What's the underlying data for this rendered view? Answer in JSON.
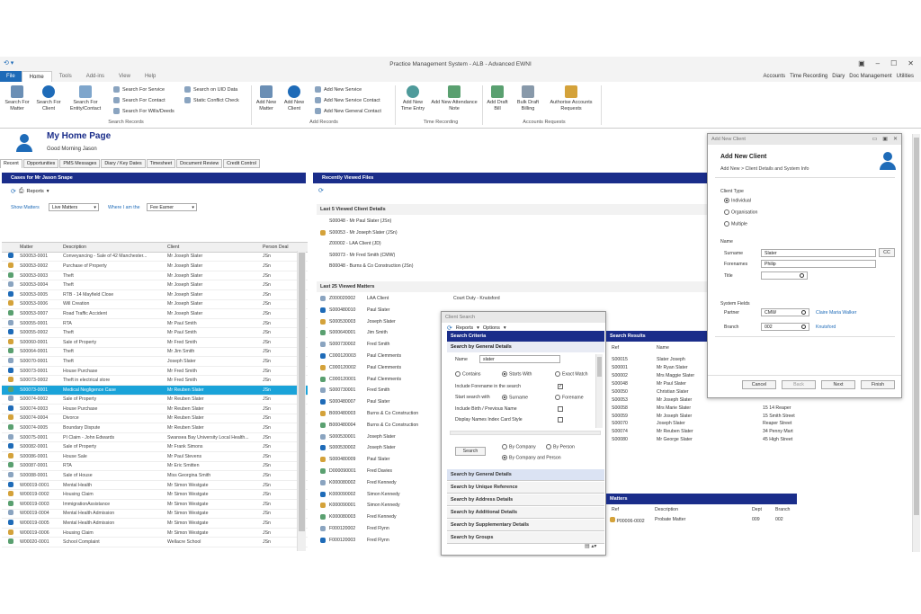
{
  "window": {
    "title": "Practice Management System - ALB - Advanced EWNI"
  },
  "menu": {
    "file": "File",
    "tabs": [
      "Home",
      "Tools",
      "Add-ins",
      "View",
      "Help"
    ],
    "right_links": [
      "Accounts",
      "Time Recording",
      "Diary",
      "Doc Management",
      "Utilities"
    ]
  },
  "ribbon": {
    "search_records": {
      "label": "Search Records",
      "buttons": [
        "Search For Matter",
        "Search For Client",
        "Search For Entity/Contact"
      ],
      "small": [
        "Search For Service",
        "Search For Contact",
        "Search For Wills/Deeds",
        "Search on UID Data",
        "Static Conflict Check"
      ]
    },
    "add_records": {
      "label": "Add Records",
      "buttons": [
        "Add New Matter",
        "Add New Client"
      ],
      "small": [
        "Add New Service",
        "Add New Service Contact",
        "Add New General Contact"
      ]
    },
    "time_recording": {
      "label": "Time Recording",
      "buttons": [
        "Add New Time Entry",
        "Add New Attendance Note"
      ]
    },
    "accounts_requests": {
      "label": "Accounts Requests",
      "buttons": [
        "Add Draft Bill",
        "Bulk Draft Billing",
        "Authorise Accounts Requests"
      ]
    }
  },
  "home": {
    "title": "My Home Page",
    "greeting": "Good Morning Jason"
  },
  "page_tabs": [
    "Recent",
    "Opportunities",
    "PMS Messages",
    "Diary / Key Dates",
    "Timesheet",
    "Document Review",
    "Credit Control"
  ],
  "cases": {
    "title": "Cases for Mr Jason Snape",
    "reports": "Reports",
    "show_matters_label": "Show Matters",
    "show_matters_value": "Live Matters",
    "where_label": "Where I am the",
    "where_value": "Fee Earner",
    "columns": [
      "Matter",
      "Description",
      "Client",
      "Person Deal"
    ],
    "rows": [
      [
        "S00053-0001",
        "Conveyancing - Sale of 42 Manchester...",
        "Mr Joseph Slater",
        "JSn"
      ],
      [
        "S00053-0002",
        "Purchase of Property",
        "Mr Joseph Slater",
        "JSn"
      ],
      [
        "S00053-0003",
        "Theft",
        "Mr Joseph Slater",
        "JSn"
      ],
      [
        "S00053-0004",
        "Theft",
        "Mr Joseph Slater",
        "JSn"
      ],
      [
        "S00053-0005",
        "RTB - 14 Mayfield Close",
        "Mr Joseph Slater",
        "JSn"
      ],
      [
        "S00053-0006",
        "Will Creation",
        "Mr Joseph Slater",
        "JSn"
      ],
      [
        "S00053-0007",
        "Road Traffic Accident",
        "Mr Joseph Slater",
        "JSn"
      ],
      [
        "S00055-0001",
        "RTA",
        "Mr Paul Smith",
        "JSn"
      ],
      [
        "S00055-0002",
        "Theft",
        "Mr Paul Smith",
        "JSn"
      ],
      [
        "S00060-0001",
        "Sale of Property",
        "Mr Fred Smith",
        "JSn"
      ],
      [
        "S00064-0001",
        "Theft",
        "Mr Jim Smith",
        "JSn"
      ],
      [
        "S00070-0001",
        "Theft",
        "Joseph Slater",
        "JSn"
      ],
      [
        "S00073-0001",
        "House Purchase",
        "Mr Fred Smith",
        "JSn"
      ],
      [
        "S00073-0002",
        "Theft in electrical store",
        "Mr Fred Smith",
        "JSn"
      ],
      [
        "S00073-0001",
        "Medical Negligence Case",
        "Mr Reuben Slater",
        "JSn"
      ],
      [
        "S00074-0002",
        "Sale of Property",
        "Mr Reuben Slater",
        "JSn"
      ],
      [
        "S00074-0003",
        "House Purchase",
        "Mr Reuben Slater",
        "JSn"
      ],
      [
        "S00074-0004",
        "Divorce",
        "Mr Reuben Slater",
        "JSn"
      ],
      [
        "S00074-0005",
        "Boundary Dispute",
        "Mr Reuben Slater",
        "JSn"
      ],
      [
        "S00075-0001",
        "PI Claim - John Edwards",
        "Swansea Bay University Local Health...",
        "JSn"
      ],
      [
        "S00082-0001",
        "Sale of Property",
        "Mr Frank Simons",
        "JSn"
      ],
      [
        "S00086-0001",
        "House Sale",
        "Mr Paul Stevens",
        "JSn"
      ],
      [
        "S00087-0001",
        "RTA",
        "Mr Eric Smitten",
        "JSn"
      ],
      [
        "S00088-0001",
        "Sale of House",
        "Miss Georgina Smith",
        "JSn"
      ],
      [
        "W00019-0001",
        "Mental Health",
        "Mr Simon Westgate",
        "JSn"
      ],
      [
        "W00019-0002",
        "Housing Claim",
        "Mr Simon Westgate",
        "JSn"
      ],
      [
        "W00019-0003",
        "ImmigrationAssistance",
        "Mr Simon Westgate",
        "JSn"
      ],
      [
        "W00019-0004",
        "Mental Health Admission",
        "Mr Simon Westgate",
        "JSn"
      ],
      [
        "W00019-0005",
        "Mental Health Admission",
        "Mr Simon Westgate",
        "JSn"
      ],
      [
        "W00019-0006",
        "Housing Claim",
        "Mr Simon Westgate",
        "JSn"
      ],
      [
        "W00020-0001",
        "School Complaint",
        "Wellacre School",
        "JSn"
      ]
    ]
  },
  "recent": {
    "title": "Recently Viewed Files",
    "clients_header": "Last 5 Viewed Client Details",
    "clients": [
      "S00048 - Mr Paul Slater (JSn)",
      "S00053 - Mr Joseph Slater (JSn)",
      "Z00002 - LAA Client (JD)",
      "S00073 - Mr Fred Smith (CMW)",
      "B00048 - Burns & Co Construction (JSn)"
    ],
    "matters_header": "Last 25 Viewed Matters",
    "matters": [
      [
        "Z000020002",
        "LAA Client",
        "Court Duty - Knutsford"
      ],
      [
        "S000480010",
        "Paul Slater",
        ""
      ],
      [
        "S000530003",
        "Joseph Slater",
        ""
      ],
      [
        "S000640001",
        "Jim Smith",
        ""
      ],
      [
        "S000730002",
        "Fred Smith",
        ""
      ],
      [
        "C000120003",
        "Paul Clemments",
        ""
      ],
      [
        "C000120002",
        "Paul Clemments",
        ""
      ],
      [
        "C000120001",
        "Paul Clemments",
        ""
      ],
      [
        "S000730001",
        "Fred Smith",
        ""
      ],
      [
        "S000480007",
        "Paul Slater",
        ""
      ],
      [
        "B000480003",
        "Burns & Co Construction",
        ""
      ],
      [
        "B000480004",
        "Burns & Co Construction",
        ""
      ],
      [
        "S000530001",
        "Joseph Slater",
        ""
      ],
      [
        "S000530002",
        "Joseph Slater",
        ""
      ],
      [
        "S000480009",
        "Paul Slater",
        ""
      ],
      [
        "D000090001",
        "Fred Davies",
        ""
      ],
      [
        "K000080002",
        "Fred Kennedy",
        ""
      ],
      [
        "K000090002",
        "Simon Kennedy",
        ""
      ],
      [
        "K000090001",
        "Simon Kennedy",
        ""
      ],
      [
        "K000080003",
        "Fred Kennedy",
        ""
      ],
      [
        "F000120002",
        "Fred Flynn",
        ""
      ],
      [
        "F000120003",
        "Fred Flynn",
        ""
      ]
    ]
  },
  "client_search": {
    "title": "Client Search",
    "reports": "Reports",
    "options": "Options",
    "criteria_header": "Search Criteria",
    "general_header": "Search by General Details",
    "name_label": "Name",
    "name_value": "slater",
    "contains": "Contains",
    "starts_with": "Starts With",
    "exact_match": "Exact Match",
    "include_forename": "Include Forename in the search",
    "start_search_with": "Start search with",
    "surname": "Surname",
    "forename": "Forename",
    "include_birth": "Include Birth / Previous Name",
    "display_names": "Display Names Index Card Style",
    "search_button": "Search",
    "by_company": "By Company",
    "by_person": "By Person",
    "by_company_person": "By Company and Person",
    "groups": [
      "Search by General Details",
      "Search by Unique Reference",
      "Search by Address Details",
      "Search by Additional Details",
      "Search by Supplementary Details",
      "Search by Groups"
    ],
    "results_header": "Search Results",
    "results_columns": [
      "Ref",
      "Name"
    ],
    "results": [
      [
        "S00015",
        "Slater Joseph",
        ""
      ],
      [
        "S00001",
        "Mr Ryan Slater",
        ""
      ],
      [
        "S00002",
        "Mrs Maggie Slater",
        ""
      ],
      [
        "S00048",
        "Mr Paul Slater",
        ""
      ],
      [
        "S00050",
        "Christian Slater",
        ""
      ],
      [
        "S00053",
        "Mr Joseph Slater",
        ""
      ],
      [
        "S00058",
        "Mrs Marie Slater",
        "15 14 Reaper"
      ],
      [
        "S00059",
        "Mr Joseph Slater",
        "15 Smith Street"
      ],
      [
        "S00070",
        "Joseph Slater",
        "Reaper Street"
      ],
      [
        "S00074",
        "Mr Reuben Slater",
        "34 Penny Mart"
      ],
      [
        "S00080",
        "Mr George Slater",
        "45 High Street"
      ]
    ],
    "matters_header": "Matters",
    "matters_columns": [
      "Ref",
      "Description",
      "Dept",
      "Branch"
    ],
    "matters_rows": [
      [
        "P00006-0002",
        "Probate Matter",
        "009",
        "002"
      ]
    ]
  },
  "add_client": {
    "window_title": "Add New Client",
    "title": "Add New Client",
    "breadcrumb": "Add New > Client Details and System Info",
    "client_type_label": "Client Type",
    "types": [
      "Individual",
      "Organisation",
      "Multiple"
    ],
    "name_label": "Name",
    "surname_label": "Surname",
    "surname_value": "Slater",
    "cc": "CC",
    "forenames_label": "Forenames",
    "forenames_value": "Philip",
    "title_label": "Title",
    "system_fields_label": "System Fields",
    "partner_label": "Partner",
    "partner_value": "CMW",
    "partner_name": "Claire Maria Walker",
    "branch_label": "Branch",
    "branch_value": "002",
    "branch_name": "Knutsford",
    "buttons": [
      "Cancel",
      "Back",
      "Next",
      "Finish"
    ]
  },
  "colors": {
    "accent": "#1e6bb8",
    "panel_header": "#1a2d8a",
    "selected_row": "#1aa3d9"
  }
}
